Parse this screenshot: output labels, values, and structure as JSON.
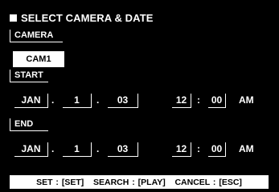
{
  "title": "SELECT CAMERA & DATE",
  "camera": {
    "label": "CAMERA",
    "value": "CAM1"
  },
  "start": {
    "label": "START",
    "month": "JAN",
    "day": "1",
    "year": "03",
    "hour": "12",
    "minute": "00",
    "ampm": "AM"
  },
  "end": {
    "label": "END",
    "month": "JAN",
    "day": "1",
    "year": "03",
    "hour": "12",
    "minute": "00",
    "ampm": "AM"
  },
  "separators": {
    "date": ".",
    "time": ":"
  },
  "footer": "SET : [SET]   SEARCH : [PLAY]   CANCEL : [ESC]"
}
